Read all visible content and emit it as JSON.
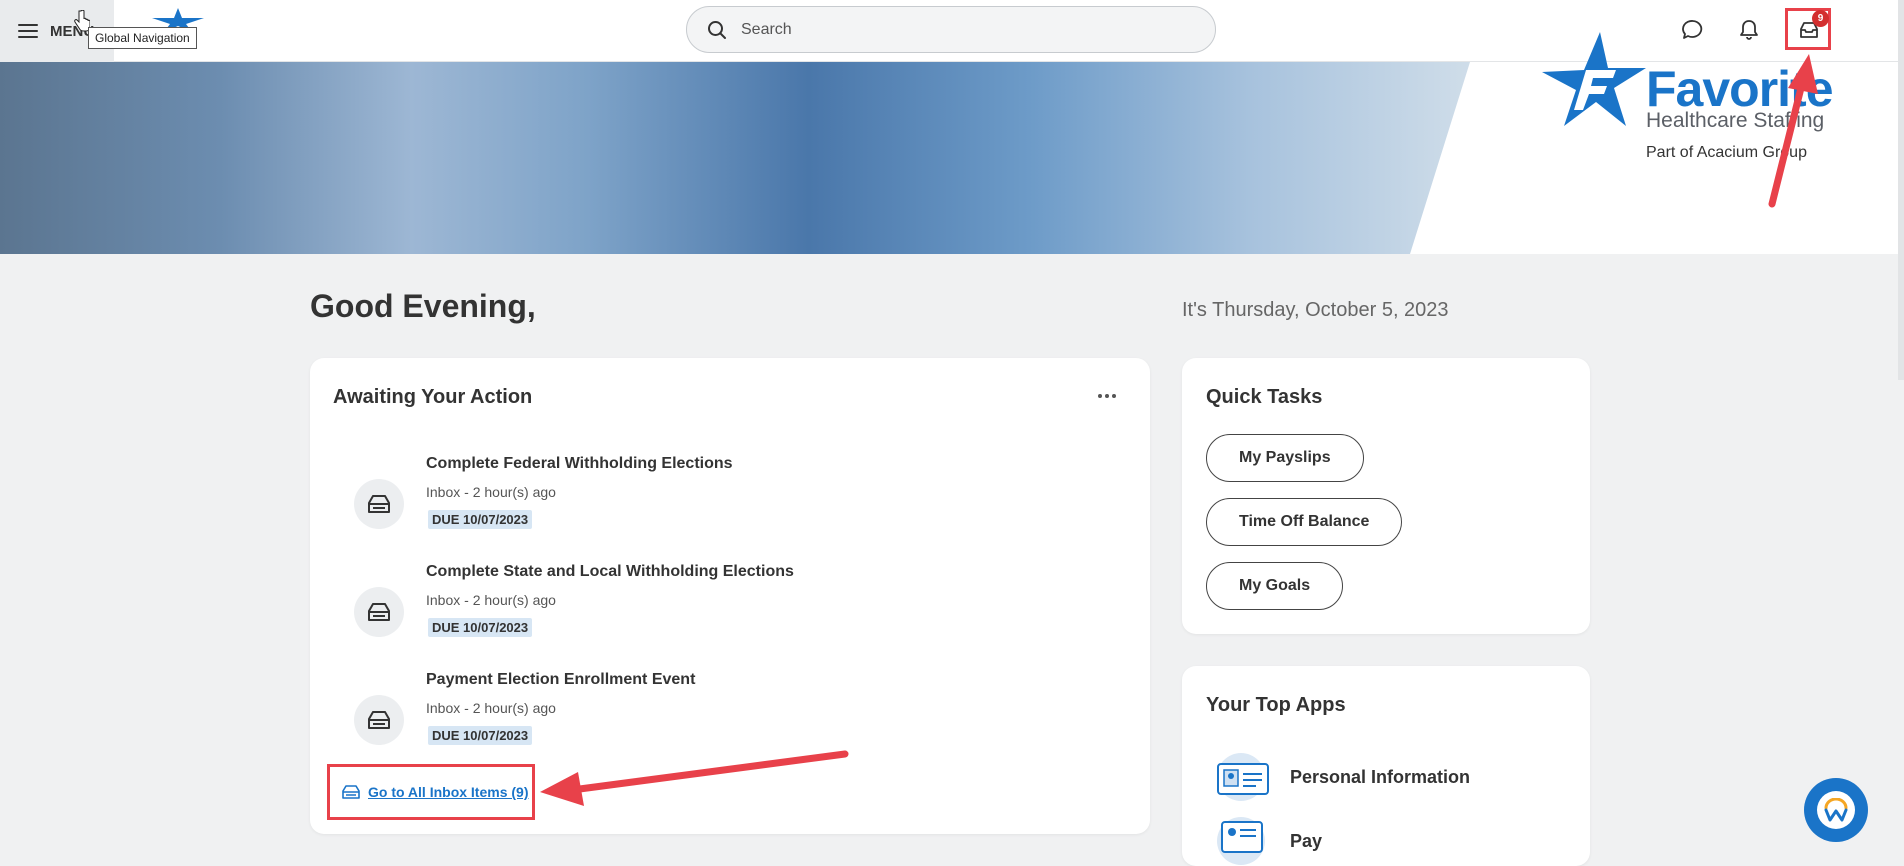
{
  "header": {
    "menu_label": "MENU",
    "tooltip": "Global Navigation",
    "search_placeholder": "Search",
    "inbox_badge": "9"
  },
  "banner": {
    "brand_name": "Favorite",
    "brand_sub": "Healthcare Staffing",
    "brand_tag": "Part of Acacium Group"
  },
  "greeting": "Good Evening,",
  "date": "It's Thursday, October 5, 2023",
  "awaiting": {
    "title": "Awaiting Your Action",
    "items": [
      {
        "title": "Complete Federal Withholding Elections",
        "sub": "Inbox - 2 hour(s) ago",
        "due": "DUE 10/07/2023"
      },
      {
        "title": "Complete State and Local Withholding Elections",
        "sub": "Inbox - 2 hour(s) ago",
        "due": "DUE 10/07/2023"
      },
      {
        "title": "Payment Election Enrollment Event",
        "sub": "Inbox - 2 hour(s) ago",
        "due": "DUE 10/07/2023"
      }
    ],
    "goto_label": "Go to All Inbox Items (9)"
  },
  "quick_tasks": {
    "title": "Quick Tasks",
    "items": [
      "My Payslips",
      "Time Off Balance",
      "My Goals"
    ]
  },
  "top_apps": {
    "title": "Your Top Apps",
    "items": [
      "Personal Information",
      "Pay"
    ]
  },
  "colors": {
    "accent": "#1a74c8",
    "annotation": "#e8414a",
    "badge": "#d32f2f"
  }
}
